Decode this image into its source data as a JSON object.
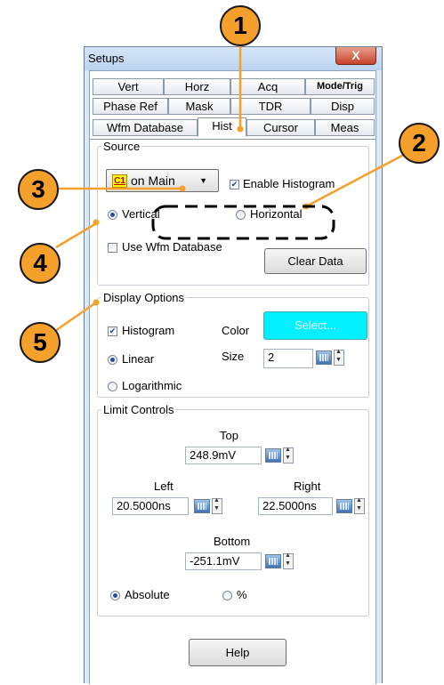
{
  "window": {
    "title": "Setups",
    "close_glyph": "X"
  },
  "tabs": {
    "row1": [
      "Vert",
      "Horz",
      "Acq",
      "Mode/Trig"
    ],
    "row2": [
      "Phase Ref",
      "Mask",
      "TDR",
      "Disp"
    ],
    "row3": [
      "Wfm Database",
      "Hist",
      "Cursor",
      "Meas"
    ],
    "active": "Hist"
  },
  "source": {
    "legend": "Source",
    "channel_badge": "C1",
    "select_value": "on Main",
    "enable_histogram": {
      "label": "Enable Histogram",
      "checked": true
    },
    "vertical": {
      "label": "Vertical",
      "selected": true
    },
    "horizontal": {
      "label": "Horizontal",
      "selected": false
    },
    "use_wfm_database": {
      "label": "Use Wfm Database",
      "checked": false
    },
    "clear_button": "Clear Data"
  },
  "display_options": {
    "legend": "Display Options",
    "histogram": {
      "label": "Histogram",
      "checked": true
    },
    "color_label": "Color",
    "select_button": "Select...",
    "linear": {
      "label": "Linear",
      "selected": true
    },
    "logarithmic": {
      "label": "Logarithmic",
      "selected": false
    },
    "size_label": "Size",
    "size_value": "2"
  },
  "limit_controls": {
    "legend": "Limit Controls",
    "top_label": "Top",
    "top_value": "248.9mV",
    "left_label": "Left",
    "left_value": "20.5000ns",
    "right_label": "Right",
    "right_value": "22.5000ns",
    "bottom_label": "Bottom",
    "bottom_value": "-251.1mV",
    "absolute": {
      "label": "Absolute",
      "selected": true
    },
    "percent": {
      "label": "%",
      "selected": false
    }
  },
  "help_button": "Help",
  "callouts": [
    "1",
    "2",
    "3",
    "4",
    "5"
  ],
  "colors": {
    "callout": "#f5a02a",
    "select_button_bg": "#00f0ff",
    "channel_badge_bg": "#ffff00"
  }
}
